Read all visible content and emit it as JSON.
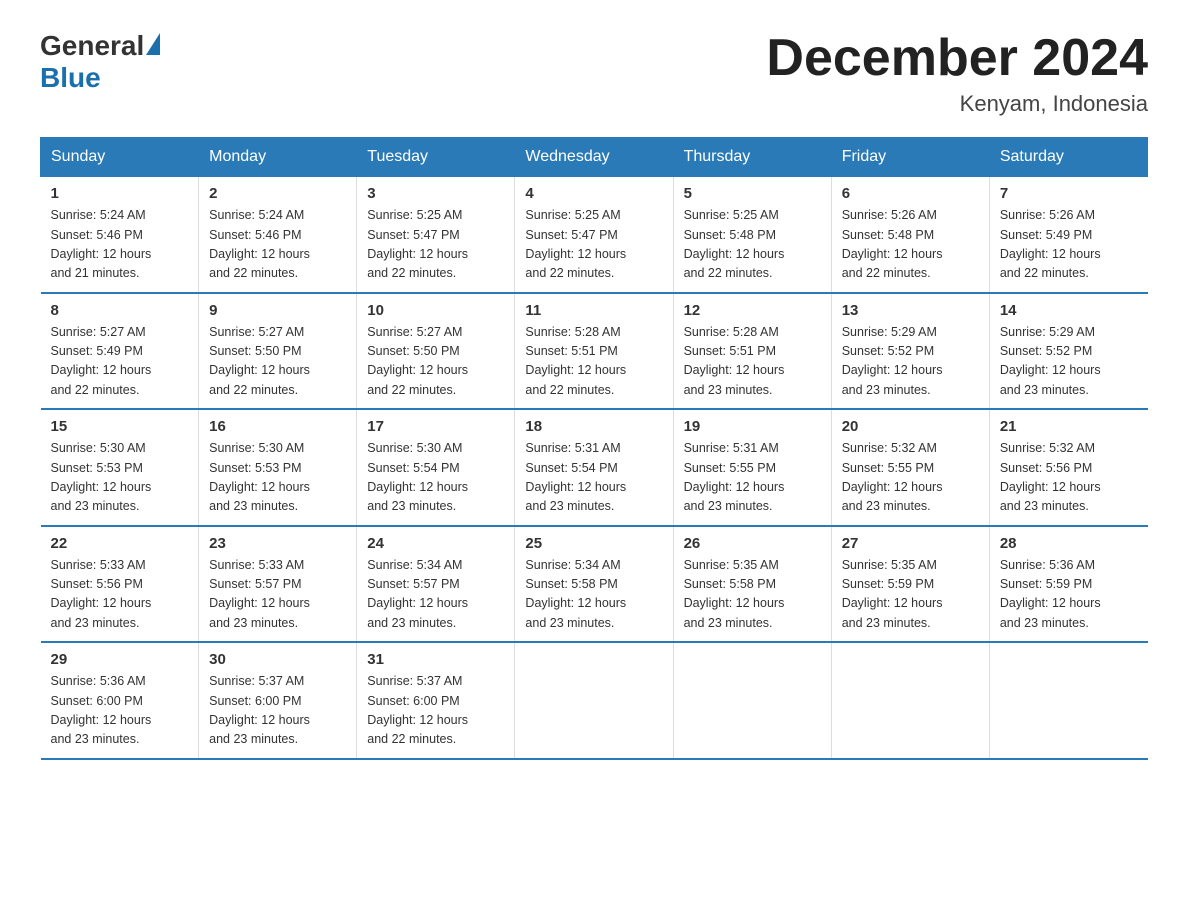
{
  "logo": {
    "general": "General",
    "blue": "Blue"
  },
  "title": "December 2024",
  "subtitle": "Kenyam, Indonesia",
  "days_header": [
    "Sunday",
    "Monday",
    "Tuesday",
    "Wednesday",
    "Thursday",
    "Friday",
    "Saturday"
  ],
  "weeks": [
    [
      {
        "day": "1",
        "sunrise": "5:24 AM",
        "sunset": "5:46 PM",
        "daylight": "12 hours and 21 minutes."
      },
      {
        "day": "2",
        "sunrise": "5:24 AM",
        "sunset": "5:46 PM",
        "daylight": "12 hours and 22 minutes."
      },
      {
        "day": "3",
        "sunrise": "5:25 AM",
        "sunset": "5:47 PM",
        "daylight": "12 hours and 22 minutes."
      },
      {
        "day": "4",
        "sunrise": "5:25 AM",
        "sunset": "5:47 PM",
        "daylight": "12 hours and 22 minutes."
      },
      {
        "day": "5",
        "sunrise": "5:25 AM",
        "sunset": "5:48 PM",
        "daylight": "12 hours and 22 minutes."
      },
      {
        "day": "6",
        "sunrise": "5:26 AM",
        "sunset": "5:48 PM",
        "daylight": "12 hours and 22 minutes."
      },
      {
        "day": "7",
        "sunrise": "5:26 AM",
        "sunset": "5:49 PM",
        "daylight": "12 hours and 22 minutes."
      }
    ],
    [
      {
        "day": "8",
        "sunrise": "5:27 AM",
        "sunset": "5:49 PM",
        "daylight": "12 hours and 22 minutes."
      },
      {
        "day": "9",
        "sunrise": "5:27 AM",
        "sunset": "5:50 PM",
        "daylight": "12 hours and 22 minutes."
      },
      {
        "day": "10",
        "sunrise": "5:27 AM",
        "sunset": "5:50 PM",
        "daylight": "12 hours and 22 minutes."
      },
      {
        "day": "11",
        "sunrise": "5:28 AM",
        "sunset": "5:51 PM",
        "daylight": "12 hours and 22 minutes."
      },
      {
        "day": "12",
        "sunrise": "5:28 AM",
        "sunset": "5:51 PM",
        "daylight": "12 hours and 23 minutes."
      },
      {
        "day": "13",
        "sunrise": "5:29 AM",
        "sunset": "5:52 PM",
        "daylight": "12 hours and 23 minutes."
      },
      {
        "day": "14",
        "sunrise": "5:29 AM",
        "sunset": "5:52 PM",
        "daylight": "12 hours and 23 minutes."
      }
    ],
    [
      {
        "day": "15",
        "sunrise": "5:30 AM",
        "sunset": "5:53 PM",
        "daylight": "12 hours and 23 minutes."
      },
      {
        "day": "16",
        "sunrise": "5:30 AM",
        "sunset": "5:53 PM",
        "daylight": "12 hours and 23 minutes."
      },
      {
        "day": "17",
        "sunrise": "5:30 AM",
        "sunset": "5:54 PM",
        "daylight": "12 hours and 23 minutes."
      },
      {
        "day": "18",
        "sunrise": "5:31 AM",
        "sunset": "5:54 PM",
        "daylight": "12 hours and 23 minutes."
      },
      {
        "day": "19",
        "sunrise": "5:31 AM",
        "sunset": "5:55 PM",
        "daylight": "12 hours and 23 minutes."
      },
      {
        "day": "20",
        "sunrise": "5:32 AM",
        "sunset": "5:55 PM",
        "daylight": "12 hours and 23 minutes."
      },
      {
        "day": "21",
        "sunrise": "5:32 AM",
        "sunset": "5:56 PM",
        "daylight": "12 hours and 23 minutes."
      }
    ],
    [
      {
        "day": "22",
        "sunrise": "5:33 AM",
        "sunset": "5:56 PM",
        "daylight": "12 hours and 23 minutes."
      },
      {
        "day": "23",
        "sunrise": "5:33 AM",
        "sunset": "5:57 PM",
        "daylight": "12 hours and 23 minutes."
      },
      {
        "day": "24",
        "sunrise": "5:34 AM",
        "sunset": "5:57 PM",
        "daylight": "12 hours and 23 minutes."
      },
      {
        "day": "25",
        "sunrise": "5:34 AM",
        "sunset": "5:58 PM",
        "daylight": "12 hours and 23 minutes."
      },
      {
        "day": "26",
        "sunrise": "5:35 AM",
        "sunset": "5:58 PM",
        "daylight": "12 hours and 23 minutes."
      },
      {
        "day": "27",
        "sunrise": "5:35 AM",
        "sunset": "5:59 PM",
        "daylight": "12 hours and 23 minutes."
      },
      {
        "day": "28",
        "sunrise": "5:36 AM",
        "sunset": "5:59 PM",
        "daylight": "12 hours and 23 minutes."
      }
    ],
    [
      {
        "day": "29",
        "sunrise": "5:36 AM",
        "sunset": "6:00 PM",
        "daylight": "12 hours and 23 minutes."
      },
      {
        "day": "30",
        "sunrise": "5:37 AM",
        "sunset": "6:00 PM",
        "daylight": "12 hours and 23 minutes."
      },
      {
        "day": "31",
        "sunrise": "5:37 AM",
        "sunset": "6:00 PM",
        "daylight": "12 hours and 22 minutes."
      },
      null,
      null,
      null,
      null
    ]
  ],
  "labels": {
    "sunrise_prefix": "Sunrise: ",
    "sunset_prefix": "Sunset: ",
    "daylight_prefix": "Daylight: "
  }
}
